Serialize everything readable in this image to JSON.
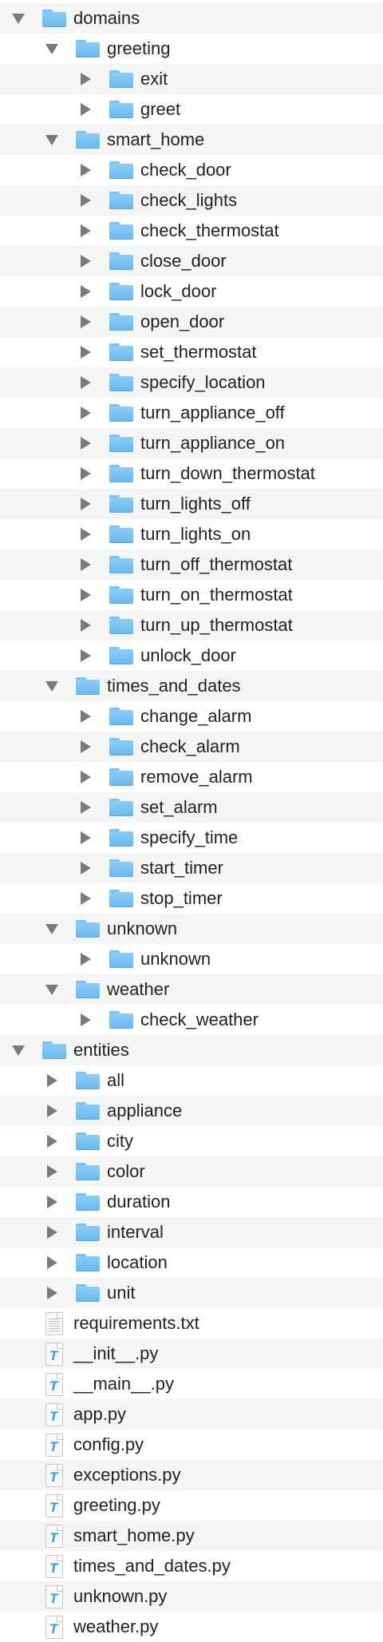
{
  "colors": {
    "folder": "#7cc2f2",
    "stripe": "#f4f5f5",
    "triangle": "#7a7a7a",
    "python_icon": "#2d9cf0"
  },
  "tree": [
    {
      "name": "domains",
      "type": "folder",
      "expanded": true,
      "children": [
        {
          "name": "greeting",
          "type": "folder",
          "expanded": true,
          "children": [
            {
              "name": "exit",
              "type": "folder"
            },
            {
              "name": "greet",
              "type": "folder"
            }
          ]
        },
        {
          "name": "smart_home",
          "type": "folder",
          "expanded": true,
          "children": [
            {
              "name": "check_door",
              "type": "folder"
            },
            {
              "name": "check_lights",
              "type": "folder"
            },
            {
              "name": "check_thermostat",
              "type": "folder"
            },
            {
              "name": "close_door",
              "type": "folder"
            },
            {
              "name": "lock_door",
              "type": "folder"
            },
            {
              "name": "open_door",
              "type": "folder"
            },
            {
              "name": "set_thermostat",
              "type": "folder"
            },
            {
              "name": "specify_location",
              "type": "folder"
            },
            {
              "name": "turn_appliance_off",
              "type": "folder"
            },
            {
              "name": "turn_appliance_on",
              "type": "folder"
            },
            {
              "name": "turn_down_thermostat",
              "type": "folder"
            },
            {
              "name": "turn_lights_off",
              "type": "folder"
            },
            {
              "name": "turn_lights_on",
              "type": "folder"
            },
            {
              "name": "turn_off_thermostat",
              "type": "folder"
            },
            {
              "name": "turn_on_thermostat",
              "type": "folder"
            },
            {
              "name": "turn_up_thermostat",
              "type": "folder"
            },
            {
              "name": "unlock_door",
              "type": "folder"
            }
          ]
        },
        {
          "name": "times_and_dates",
          "type": "folder",
          "expanded": true,
          "children": [
            {
              "name": "change_alarm",
              "type": "folder"
            },
            {
              "name": "check_alarm",
              "type": "folder"
            },
            {
              "name": "remove_alarm",
              "type": "folder"
            },
            {
              "name": "set_alarm",
              "type": "folder"
            },
            {
              "name": "specify_time",
              "type": "folder"
            },
            {
              "name": "start_timer",
              "type": "folder"
            },
            {
              "name": "stop_timer",
              "type": "folder"
            }
          ]
        },
        {
          "name": "unknown",
          "type": "folder",
          "expanded": true,
          "children": [
            {
              "name": "unknown",
              "type": "folder"
            }
          ]
        },
        {
          "name": "weather",
          "type": "folder",
          "expanded": true,
          "children": [
            {
              "name": "check_weather",
              "type": "folder"
            }
          ]
        }
      ]
    },
    {
      "name": "entities",
      "type": "folder",
      "expanded": true,
      "children": [
        {
          "name": "all",
          "type": "folder"
        },
        {
          "name": "appliance",
          "type": "folder"
        },
        {
          "name": "city",
          "type": "folder"
        },
        {
          "name": "color",
          "type": "folder"
        },
        {
          "name": "duration",
          "type": "folder"
        },
        {
          "name": "interval",
          "type": "folder"
        },
        {
          "name": "location",
          "type": "folder"
        },
        {
          "name": "unit",
          "type": "folder"
        }
      ]
    },
    {
      "name": "requirements.txt",
      "type": "txt"
    },
    {
      "name": "__init__.py",
      "type": "py"
    },
    {
      "name": "__main__.py",
      "type": "py"
    },
    {
      "name": "app.py",
      "type": "py"
    },
    {
      "name": "config.py",
      "type": "py"
    },
    {
      "name": "exceptions.py",
      "type": "py"
    },
    {
      "name": "greeting.py",
      "type": "py"
    },
    {
      "name": "smart_home.py",
      "type": "py"
    },
    {
      "name": "times_and_dates.py",
      "type": "py"
    },
    {
      "name": "unknown.py",
      "type": "py"
    },
    {
      "name": "weather.py",
      "type": "py"
    }
  ]
}
